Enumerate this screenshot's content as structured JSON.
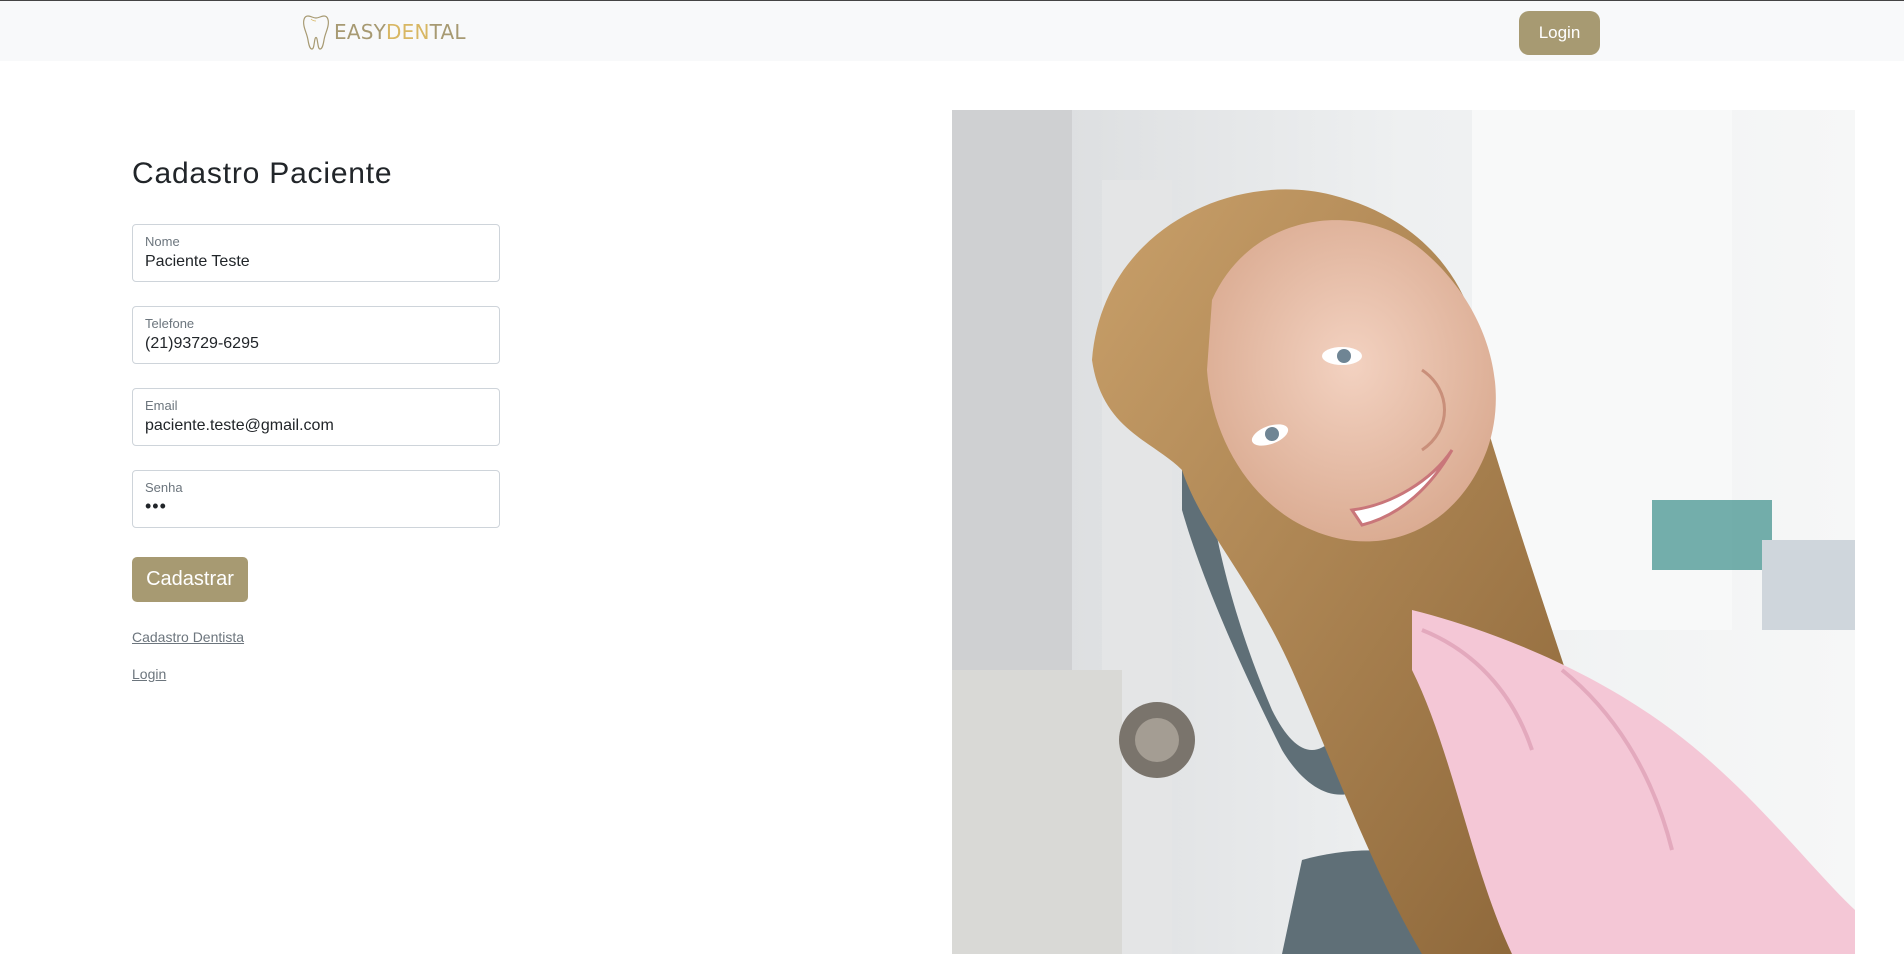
{
  "header": {
    "logo_text_part1": "EASY",
    "logo_text_part2": "DEN",
    "logo_text_part3": "TAL",
    "logo_icon": "tooth-icon",
    "login_label": "Login"
  },
  "form": {
    "title": "Cadastro Paciente",
    "fields": [
      {
        "label": "Nome",
        "value": "Paciente Teste"
      },
      {
        "label": "Telefone",
        "value": "(21)93729-6295"
      },
      {
        "label": "Email",
        "value": "paciente.teste@gmail.com"
      },
      {
        "label": "Senha",
        "value": "•••"
      }
    ],
    "submit_label": "Cadastrar",
    "links": [
      "Cadastro Dentista",
      "Login"
    ]
  },
  "colors": {
    "accent": "#a79a72",
    "logo_gold": "#d8b763",
    "navbar_bg": "#f8f9fa"
  }
}
